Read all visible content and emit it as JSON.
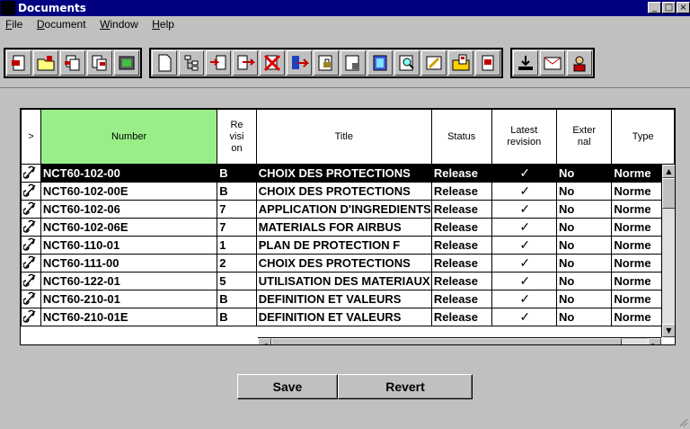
{
  "window": {
    "title": "Documents",
    "min": "_",
    "max": "□",
    "close": "×"
  },
  "menu": [
    {
      "label": "File",
      "ul": "F",
      "rest": "ile"
    },
    {
      "label": "Document",
      "ul": "D",
      "rest": "ocument"
    },
    {
      "label": "Window",
      "ul": "W",
      "rest": "indow"
    },
    {
      "label": "Help",
      "ul": "H",
      "rest": "elp"
    }
  ],
  "toolbar_icons": [
    "document-red-icon",
    "open-folder-icon",
    "copy-doc-icon",
    "duplicate-doc-icon",
    "print-preview-icon",
    "new-page-icon",
    "tree-structure-icon",
    "import-icon",
    "export-icon",
    "delete-icon",
    "move-right-icon",
    "lock-icon",
    "doc-lock-icon",
    "book-icon",
    "search-doc-icon",
    "edit-doc-icon",
    "folder-doc-icon",
    "red-doc-icon",
    "download-icon",
    "mail-icon",
    "user-icon"
  ],
  "table": {
    "headers": {
      "expand": ">",
      "number": "Number",
      "revision": [
        "Re",
        "visi",
        "on"
      ],
      "title": "Title",
      "status": "Status",
      "latest": [
        "Latest",
        "revision"
      ],
      "external": [
        "Exter",
        "nal"
      ],
      "type": "Type"
    },
    "rows": [
      {
        "number": "NCT60-102-00",
        "revision": "B",
        "title": "CHOIX DES PROTECTIONS",
        "status": "Release",
        "latest": "✓",
        "external": "No",
        "type": "Norme",
        "selected": true
      },
      {
        "number": "NCT60-102-00E",
        "revision": "B",
        "title": "CHOIX DES PROTECTIONS",
        "status": "Release",
        "latest": "✓",
        "external": "No",
        "type": "Norme"
      },
      {
        "number": "NCT60-102-06",
        "revision": "7",
        "title": "APPLICATION D'INGREDIENTS",
        "status": "Release",
        "latest": "✓",
        "external": "No",
        "type": "Norme"
      },
      {
        "number": "NCT60-102-06E",
        "revision": "7",
        "title": "MATERIALS FOR AIRBUS",
        "status": "Release",
        "latest": "✓",
        "external": "No",
        "type": "Norme"
      },
      {
        "number": "NCT60-110-01",
        "revision": "1",
        "title": "PLAN DE PROTECTION F",
        "status": "Release",
        "latest": "✓",
        "external": "No",
        "type": "Norme"
      },
      {
        "number": "NCT60-111-00",
        "revision": "2",
        "title": "CHOIX DES PROTECTIONS",
        "status": "Release",
        "latest": "✓",
        "external": "No",
        "type": "Norme"
      },
      {
        "number": "NCT60-122-01",
        "revision": "5",
        "title": "UTILISATION DES MATERIAUX",
        "status": "Release",
        "latest": "✓",
        "external": "No",
        "type": "Norme"
      },
      {
        "number": "NCT60-210-01",
        "revision": "B",
        "title": "DEFINITION ET VALEURS",
        "status": "Release",
        "latest": "✓",
        "external": "No",
        "type": "Norme"
      },
      {
        "number": "NCT60-210-01E",
        "revision": "B",
        "title": "DEFINITION ET VALEURS",
        "status": "Release",
        "latest": "✓",
        "external": "No",
        "type": "Norme"
      }
    ]
  },
  "scroll": {
    "up": "▲",
    "down": "▼",
    "left": "◄",
    "right": "►"
  },
  "buttons": {
    "save": "Save",
    "revert": "Revert"
  }
}
